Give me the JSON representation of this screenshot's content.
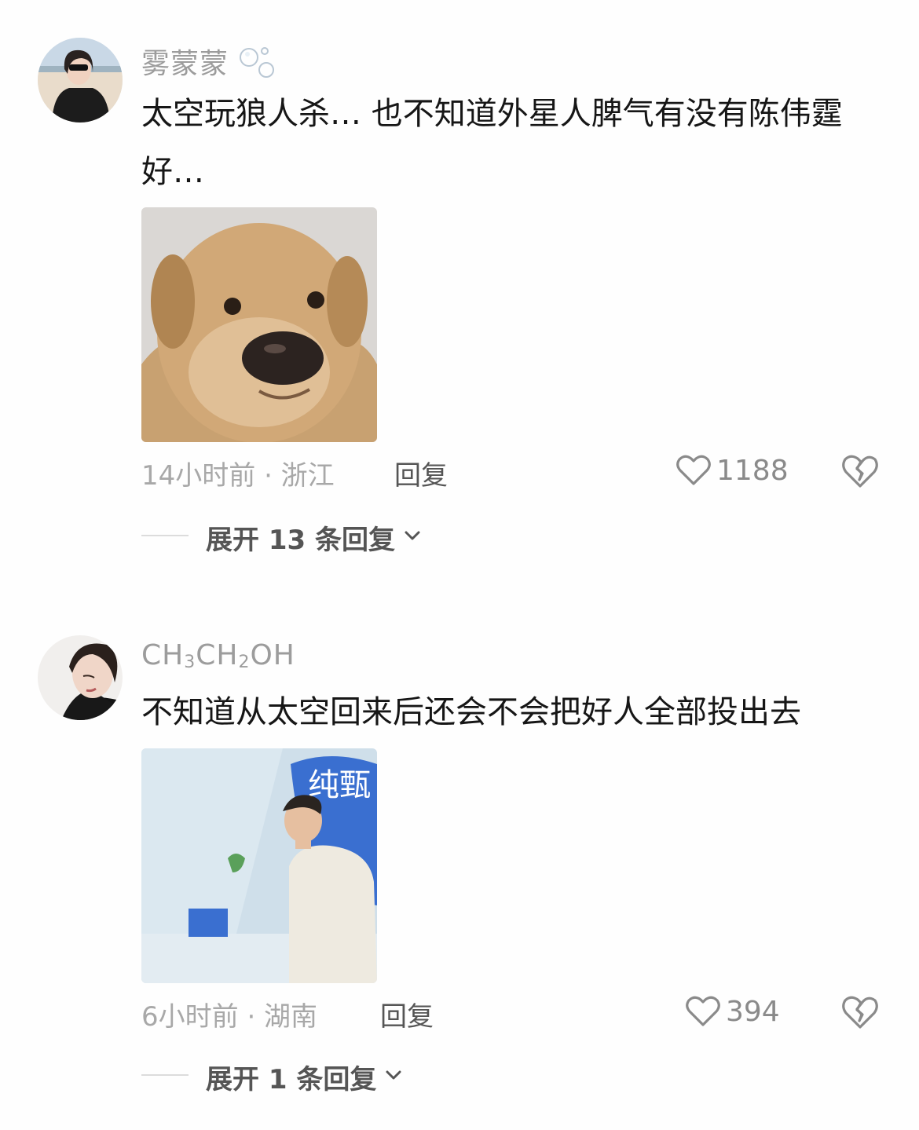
{
  "comments": [
    {
      "username": "雾蒙蒙",
      "text": "太空玩狼人杀… 也不知道外星人脾气有没有陈伟霆好…",
      "time_location": "14小时前 · 浙江",
      "reply_label": "回复",
      "like_count": "1188",
      "expand_label": "展开 13 条回复",
      "image": "dog-meme"
    },
    {
      "username_parts": [
        "CH",
        "3",
        "CH",
        "2",
        "OH"
      ],
      "text": "不知道从太空回来后还会不会把好人全部投出去",
      "time_location": "6小时前 · 湖南",
      "reply_label": "回复",
      "like_count": "394",
      "expand_label": "展开 1 条回复",
      "image": "man-at-event",
      "image_sign_text": "纯甄"
    }
  ],
  "icons": {
    "like": "heart-outline-icon",
    "dislike": "broken-heart-icon",
    "expand": "chevron-down-icon",
    "username_badge": "bubbles-icon"
  },
  "colors": {
    "username": "#9c9c9c",
    "text": "#161616",
    "meta": "#a8a8a8",
    "action": "#555555"
  }
}
